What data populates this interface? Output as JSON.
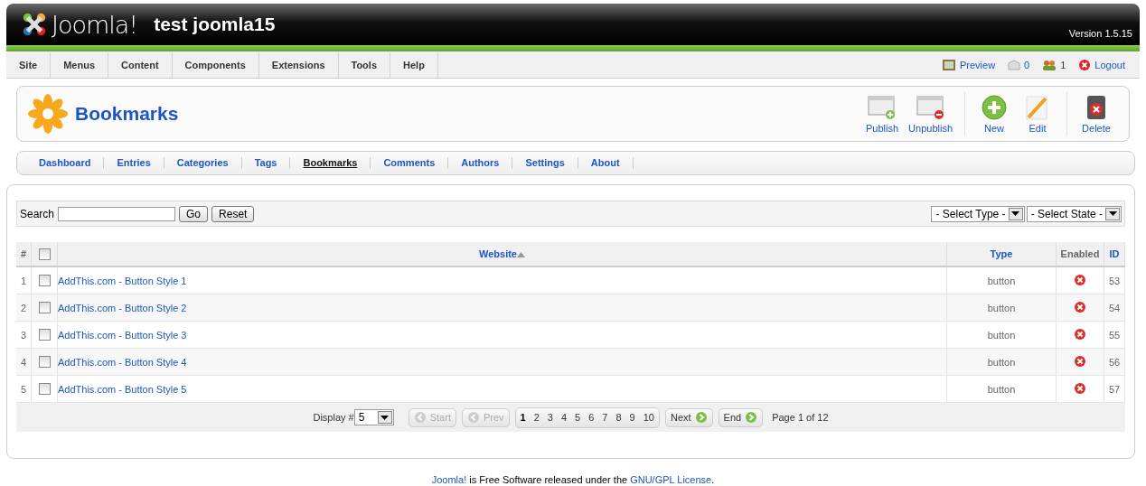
{
  "header": {
    "brand": "Joomla!",
    "site_title": "test joomla15",
    "version": "Version 1.5.15"
  },
  "menu": [
    "Site",
    "Menus",
    "Content",
    "Components",
    "Extensions",
    "Tools",
    "Help"
  ],
  "status": {
    "preview": "Preview",
    "messages": "0",
    "users": "1",
    "logout": "Logout"
  },
  "toolbar": {
    "title": "Bookmarks",
    "buttons": [
      {
        "label": "Publish",
        "kind": "publish"
      },
      {
        "label": "Unpublish",
        "kind": "unpublish"
      },
      {
        "label": "New",
        "kind": "new"
      },
      {
        "label": "Edit",
        "kind": "edit"
      },
      {
        "label": "Delete",
        "kind": "delete"
      }
    ]
  },
  "tabs": [
    {
      "label": "Dashboard",
      "selected": false
    },
    {
      "label": "Entries",
      "selected": false
    },
    {
      "label": "Categories",
      "selected": false
    },
    {
      "label": "Tags",
      "selected": false
    },
    {
      "label": "Bookmarks",
      "selected": true
    },
    {
      "label": "Comments",
      "selected": false
    },
    {
      "label": "Authors",
      "selected": false
    },
    {
      "label": "Settings",
      "selected": false
    },
    {
      "label": "About",
      "selected": false
    }
  ],
  "filter": {
    "label": "Search",
    "go": "Go",
    "reset": "Reset",
    "selects": [
      "- Select Type -",
      "- Select State -"
    ]
  },
  "table": {
    "columns": [
      "#",
      "Website",
      "Type",
      "Enabled",
      "ID"
    ],
    "select_all_checked": false,
    "rows": [
      {
        "num": "1",
        "website": "AddThis.com - Button Style 1",
        "type": "button",
        "enabled": false,
        "checked": false,
        "id": "53"
      },
      {
        "num": "2",
        "website": "AddThis.com - Button Style 2",
        "type": "button",
        "enabled": false,
        "checked": false,
        "id": "54"
      },
      {
        "num": "3",
        "website": "AddThis.com - Button Style 3",
        "type": "button",
        "enabled": false,
        "checked": false,
        "id": "55"
      },
      {
        "num": "4",
        "website": "AddThis.com - Button Style 4",
        "type": "button",
        "enabled": false,
        "checked": false,
        "id": "56"
      },
      {
        "num": "5",
        "website": "AddThis.com - Button Style 5",
        "type": "button",
        "enabled": false,
        "checked": false,
        "id": "57"
      }
    ]
  },
  "pagination": {
    "display_label": "Display #",
    "display_value": "5",
    "nav": [
      {
        "label": "Start",
        "disabled": true,
        "kind": "back"
      },
      {
        "label": "Prev",
        "disabled": true,
        "kind": "back"
      }
    ],
    "pages": [
      {
        "label": "1",
        "selected": true
      },
      {
        "label": "2",
        "selected": false
      },
      {
        "label": "3",
        "selected": false
      },
      {
        "label": "4",
        "selected": false
      },
      {
        "label": "5",
        "selected": false
      },
      {
        "label": "6",
        "selected": false
      },
      {
        "label": "7",
        "selected": false
      },
      {
        "label": "8",
        "selected": false
      },
      {
        "label": "9",
        "selected": false
      },
      {
        "label": "10",
        "selected": false
      }
    ],
    "nav_after": [
      {
        "label": "Next",
        "disabled": false,
        "kind": "forward"
      },
      {
        "label": "End",
        "disabled": false,
        "kind": "forward"
      }
    ],
    "page_info": "Page 1 of 12"
  },
  "footer": [
    {
      "text": "Joomla!",
      "link": true
    },
    {
      "text": "is Free Software released under the",
      "link": false
    },
    {
      "text": "GNU/GPL License",
      "link": true
    },
    {
      "text": ".",
      "link": false
    }
  ]
}
